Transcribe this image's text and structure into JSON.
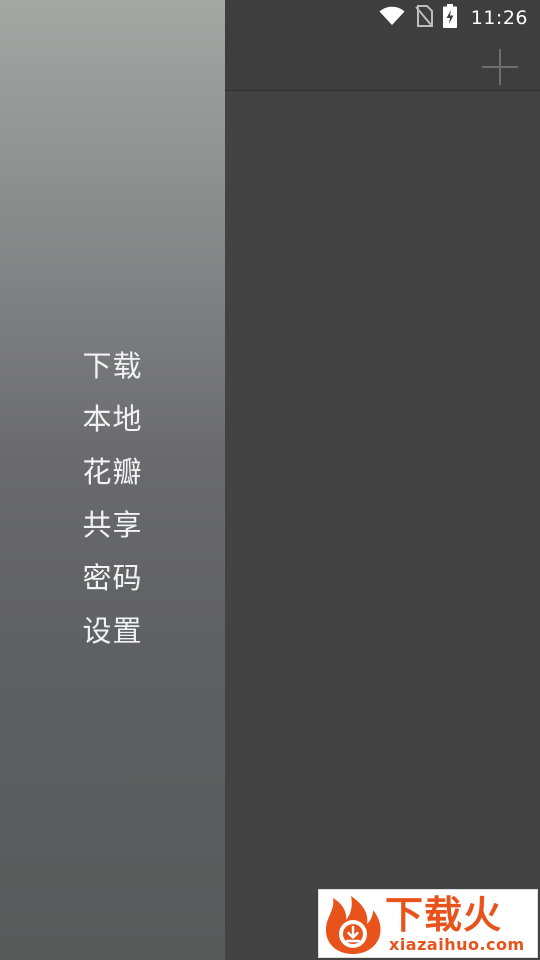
{
  "status_bar": {
    "time": "11:26",
    "icons": [
      "wifi-icon",
      "no-sim-icon",
      "battery-charging-icon"
    ]
  },
  "toolbar": {
    "add_icon": "plus-icon"
  },
  "drawer": {
    "items": [
      {
        "label": "下载"
      },
      {
        "label": "本地"
      },
      {
        "label": "花瓣"
      },
      {
        "label": "共享"
      },
      {
        "label": "密码"
      },
      {
        "label": "设置"
      }
    ]
  },
  "watermark": {
    "title": "下载火",
    "domain": "xiazaihuo.com"
  },
  "colors": {
    "background": "#434343",
    "toolbar": "#3e3e3e",
    "drawer_top": "#a3a7a4",
    "drawer_bottom": "#585a5a",
    "menu_text": "#f2f2f2",
    "brand_orange": "#e8531c"
  }
}
